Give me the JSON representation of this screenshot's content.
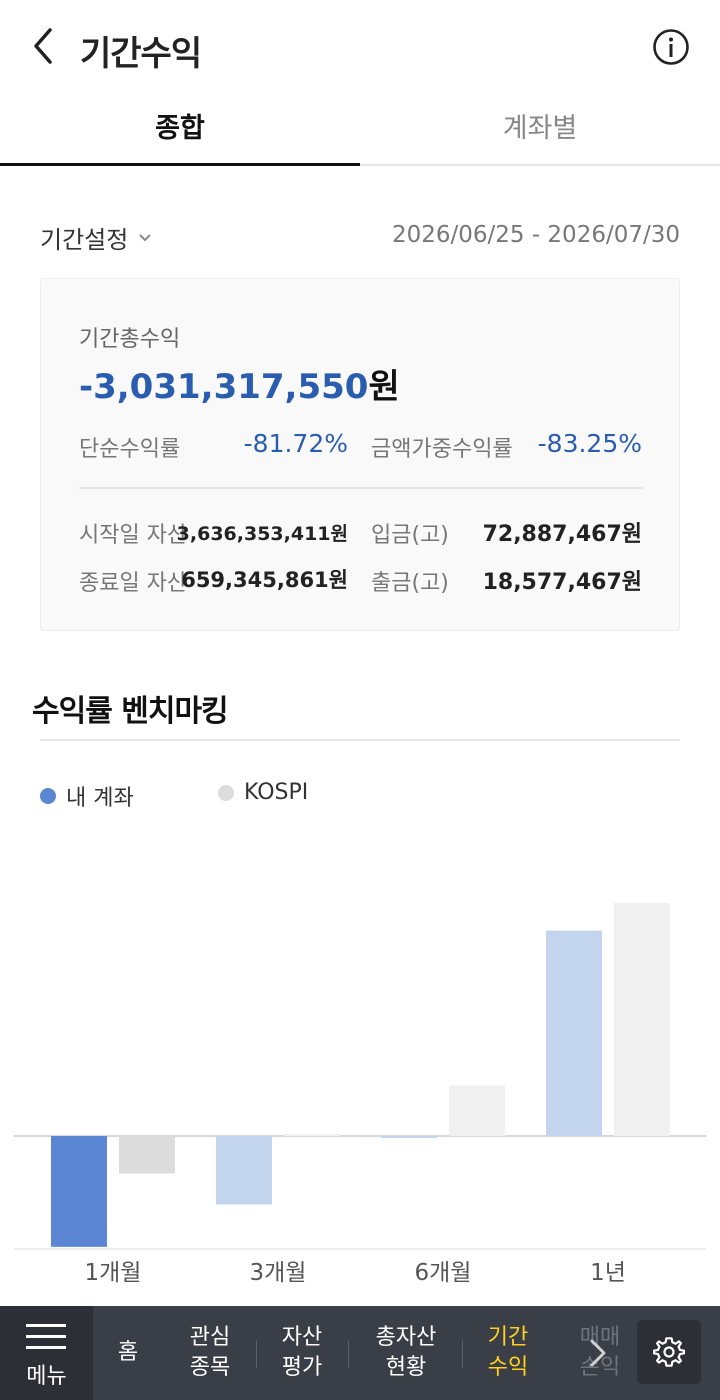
{
  "header": {
    "title": "기간수익"
  },
  "tabs": [
    {
      "label": "종합"
    },
    {
      "label": "계좌별"
    }
  ],
  "period": {
    "select_label": "기간설정",
    "range": "2026/06/25 - 2026/07/30"
  },
  "summary": {
    "total_label": "기간총수익",
    "total_value": "-3,031,317,550",
    "total_unit": "원",
    "simple_rate_label": "단순수익률",
    "simple_rate_value": "-81.72%",
    "weighted_rate_label": "금액가중수익률",
    "weighted_rate_value": "-83.25%",
    "start_asset_label": "시작일 자산",
    "start_asset_value": "3,636,353,411원",
    "end_asset_label": "종료일 자산",
    "end_asset_value": "659,345,861원",
    "deposit_label": "입금(고)",
    "deposit_value": "72,887,467원",
    "withdraw_label": "출금(고)",
    "withdraw_value": "18,577,467원"
  },
  "benchmark": {
    "title": "수익률 벤치마킹"
  },
  "colors": {
    "accent": "#2a5db0",
    "my_account_active": "#5b86d4",
    "my_account": "#c3d4ef",
    "kospi": "#f0f0f0",
    "kospi_active": "#dcdcdc"
  },
  "chart_data": {
    "type": "bar",
    "categories": [
      "1개월",
      "3개월",
      "6개월",
      "1년"
    ],
    "series": [
      {
        "name": "내 계좌",
        "values": [
          -68,
          -42,
          -1,
          126
        ]
      },
      {
        "name": "KOSPI",
        "values": [
          -23,
          0,
          31,
          143
        ]
      }
    ],
    "ylim": [
      -70,
      145
    ],
    "grid": false,
    "legend": "top-left"
  },
  "bottom_nav": {
    "menu_label": "메뉴",
    "items": [
      {
        "label": "홈"
      },
      {
        "label": "관심\n종목"
      },
      {
        "label": "자산\n평가"
      },
      {
        "label": "총자산\n현황"
      },
      {
        "label": "기간\n수익"
      },
      {
        "label": "매매\n손익"
      }
    ]
  }
}
